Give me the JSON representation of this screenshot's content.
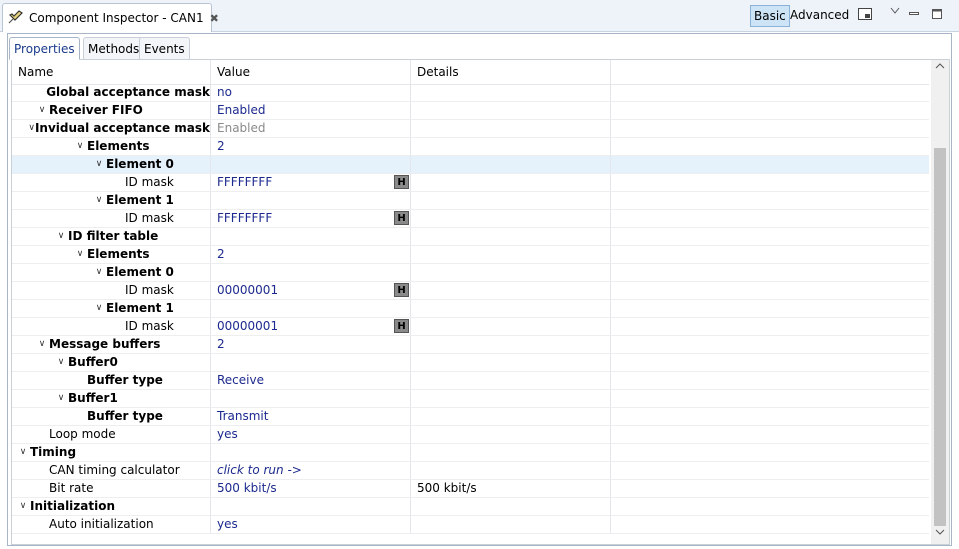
{
  "view": {
    "title": "Component Inspector - CAN1",
    "close_symbol": "✖",
    "icon": "component-inspector-icon"
  },
  "toolbar": {
    "basic_label": "Basic",
    "advanced_label": "Advanced"
  },
  "tabs": {
    "properties": "Properties",
    "methods": "Methods",
    "events": "Events"
  },
  "columns": {
    "name": "Name",
    "value": "Value",
    "details": "Details"
  },
  "rows": [
    {
      "name": "Global acceptance mask",
      "indent": 2,
      "bold": true,
      "chevron": false,
      "value": "no"
    },
    {
      "name": "Receiver FIFO",
      "indent": 1,
      "bold": true,
      "chevron": true,
      "value": "Enabled"
    },
    {
      "name": "Invidual acceptance mask",
      "indent": 2,
      "bold": true,
      "chevron": true,
      "value": "Enabled",
      "value_style": "grey"
    },
    {
      "name": "Elements",
      "indent": 3,
      "bold": true,
      "chevron": true,
      "value": "2"
    },
    {
      "name": "Element 0",
      "indent": 4,
      "bold": true,
      "chevron": true,
      "value": "",
      "selected": true
    },
    {
      "name": "ID mask",
      "indent": 5,
      "bold": false,
      "chevron": false,
      "value": "FFFFFFFF",
      "hbutton": true
    },
    {
      "name": "Element 1",
      "indent": 4,
      "bold": true,
      "chevron": true,
      "value": ""
    },
    {
      "name": "ID mask",
      "indent": 5,
      "bold": false,
      "chevron": false,
      "value": "FFFFFFFF",
      "hbutton": true
    },
    {
      "name": "ID filter table",
      "indent": 2,
      "bold": true,
      "chevron": true,
      "value": ""
    },
    {
      "name": "Elements",
      "indent": 3,
      "bold": true,
      "chevron": true,
      "value": "2"
    },
    {
      "name": "Element 0",
      "indent": 4,
      "bold": true,
      "chevron": true,
      "value": ""
    },
    {
      "name": "ID mask",
      "indent": 5,
      "bold": false,
      "chevron": false,
      "value": "00000001",
      "hbutton": true
    },
    {
      "name": "Element 1",
      "indent": 4,
      "bold": true,
      "chevron": true,
      "value": ""
    },
    {
      "name": "ID mask",
      "indent": 5,
      "bold": false,
      "chevron": false,
      "value": "00000001",
      "hbutton": true
    },
    {
      "name": "Message buffers",
      "indent": 1,
      "bold": true,
      "chevron": true,
      "value": "2"
    },
    {
      "name": "Buffer0",
      "indent": 2,
      "bold": true,
      "chevron": true,
      "value": ""
    },
    {
      "name": "Buffer type",
      "indent": 3,
      "bold": true,
      "chevron": false,
      "value": "Receive"
    },
    {
      "name": "Buffer1",
      "indent": 2,
      "bold": true,
      "chevron": true,
      "value": ""
    },
    {
      "name": "Buffer type",
      "indent": 3,
      "bold": true,
      "chevron": false,
      "value": "Transmit"
    },
    {
      "name": "Loop mode",
      "indent": 1,
      "bold": false,
      "chevron": false,
      "value": "yes"
    },
    {
      "name": "Timing",
      "indent": 0,
      "bold": true,
      "chevron": true,
      "value": ""
    },
    {
      "name": "CAN timing calculator",
      "indent": 1,
      "bold": false,
      "chevron": false,
      "value": "click to run ->",
      "value_style": "italic"
    },
    {
      "name": "Bit rate",
      "indent": 1,
      "bold": false,
      "chevron": false,
      "value": "500 kbit/s",
      "details": "500 kbit/s"
    },
    {
      "name": "Initialization",
      "indent": 0,
      "bold": true,
      "chevron": true,
      "value": ""
    },
    {
      "name": "Auto initialization",
      "indent": 1,
      "bold": false,
      "chevron": false,
      "value": "yes"
    }
  ],
  "hbutton_label": "H",
  "chevron_symbol": "∨",
  "icons": {
    "view_menu": "view-menu-icon",
    "minimize": "minimize-icon",
    "maximize": "maximize-icon",
    "layout": "layout-icon",
    "scroll_up": "scroll-up-icon",
    "scroll_down": "scroll-down-icon"
  }
}
